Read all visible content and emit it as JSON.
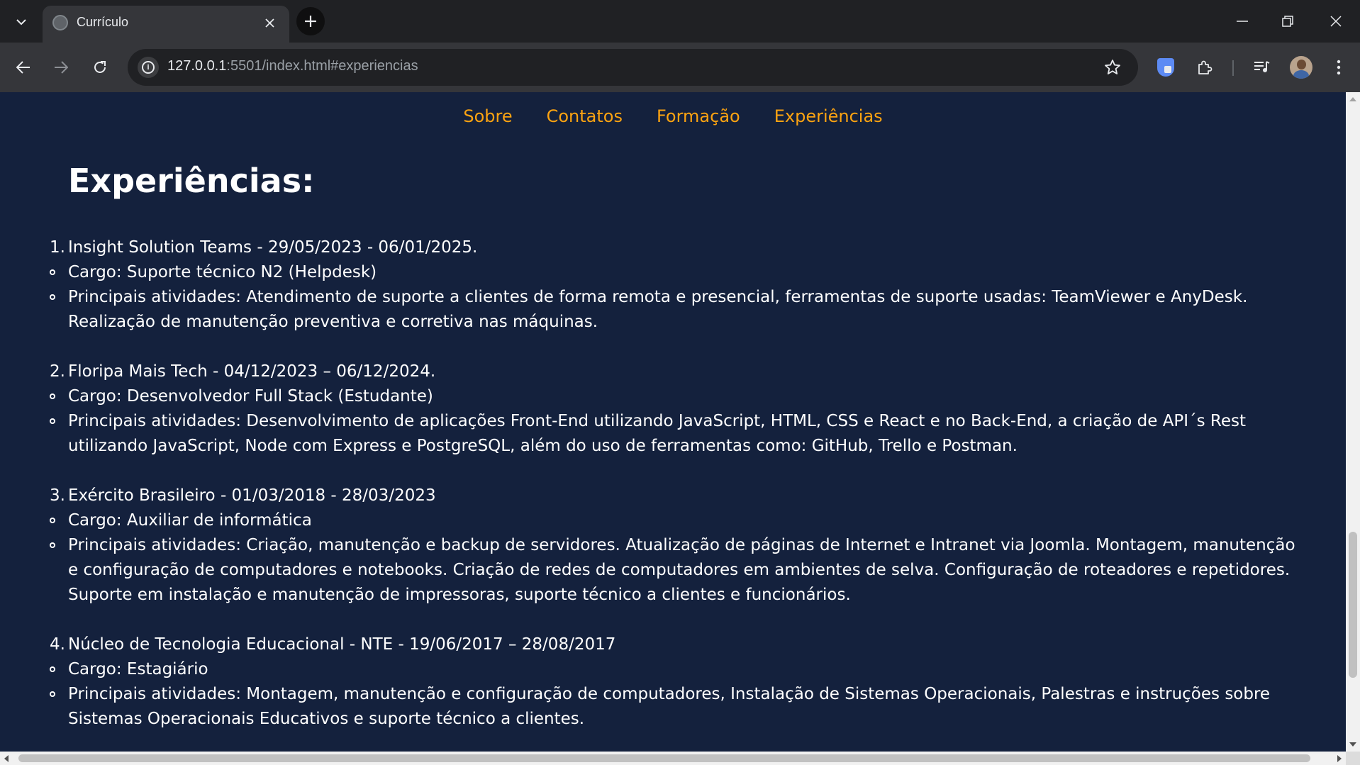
{
  "browser": {
    "tab_title": "Currículo",
    "url_host": "127.0.0.1",
    "url_rest": ":5501/index.html#experiencias",
    "icons": {
      "tab_list": "chevron-down-icon",
      "favicon": "globe-icon",
      "close_tab": "close-icon",
      "new_tab": "plus-icon",
      "minimize": "minimize-icon",
      "restore": "restore-icon",
      "close_window": "close-icon",
      "back": "arrow-left-icon",
      "forward": "arrow-right-icon",
      "reload": "reload-icon",
      "site_info": "info-icon",
      "bookmark": "star-icon",
      "shield_extension": "shield-icon",
      "extensions": "puzzle-icon",
      "media": "media-control-icon",
      "profile": "avatar",
      "menu": "kebab-menu-icon"
    }
  },
  "page": {
    "nav": [
      "Sobre",
      "Contatos",
      "Formação",
      "Experiências"
    ],
    "title": "Experiências:",
    "experiences": [
      {
        "number": "1.",
        "heading": "Insight Solution Teams - 29/05/2023 - 06/01/2025.",
        "role": "Cargo: Suporte técnico N2 (Helpdesk)",
        "activities": "Principais atividades: Atendimento de suporte a clientes de forma remota e presencial, ferramentas de suporte usadas: TeamViewer e AnyDesk. Realização de manutenção preventiva e corretiva nas máquinas."
      },
      {
        "number": "2.",
        "heading": "Floripa Mais Tech - 04/12/2023 – 06/12/2024.",
        "role": "Cargo: Desenvolvedor Full Stack (Estudante)",
        "activities": "Principais atividades: Desenvolvimento de aplicações Front-End utilizando JavaScript, HTML, CSS e React e no Back-End, a criação de API´s Rest utilizando JavaScript, Node com Express e PostgreSQL, além do uso de ferramentas como: GitHub, Trello e Postman."
      },
      {
        "number": "3.",
        "heading": "Exército Brasileiro - 01/03/2018 - 28/03/2023",
        "role": "Cargo: Auxiliar de informática",
        "activities": "Principais atividades: Criação, manutenção e backup de servidores. Atualização de páginas de Internet e Intranet via Joomla. Montagem, manutenção e configuração de computadores e notebooks. Criação de redes de computadores em ambientes de selva. Configuração de roteadores e repetidores. Suporte em instalação e manutenção de impressoras, suporte técnico a clientes e funcionários."
      },
      {
        "number": "4.",
        "heading": "Núcleo de Tecnologia Educacional - NTE - 19/06/2017 – 28/08/2017",
        "role": "Cargo: Estagiário",
        "activities": "Principais atividades: Montagem, manutenção e configuração de computadores, Instalação de Sistemas Operacionais, Palestras e instruções sobre Sistemas Operacionais Educativos e suporte técnico a clientes."
      }
    ]
  },
  "colors": {
    "page_background": "#14213d",
    "nav_link": "#fca311",
    "text": "#ffffff",
    "browser_frame": "#202124",
    "toolbar": "#35363a"
  }
}
